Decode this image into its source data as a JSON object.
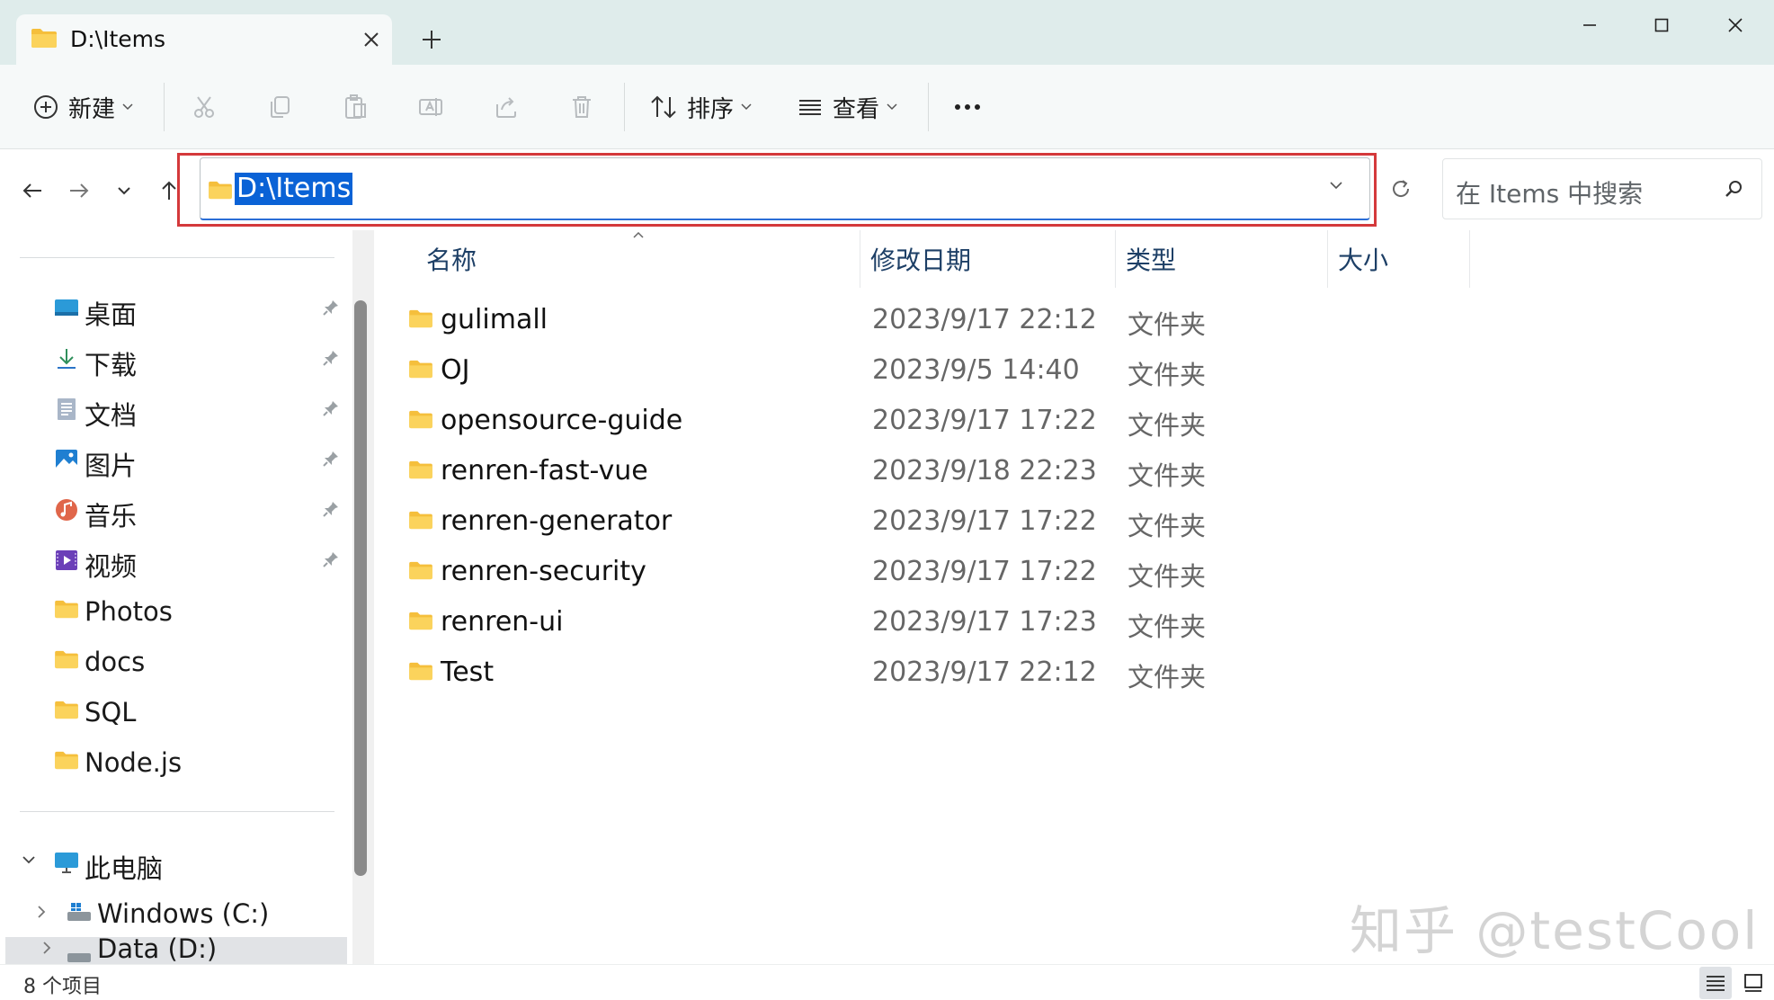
{
  "tab": {
    "title": "D:\\Items"
  },
  "toolbar": {
    "new_label": "新建",
    "sort_label": "排序",
    "view_label": "查看",
    "more_label": "···"
  },
  "address": {
    "path": "D:\\Items"
  },
  "search": {
    "placeholder": "在 Items 中搜索"
  },
  "sidebar": {
    "quick_access": [
      {
        "label": "桌面",
        "icon": "desktop-icon",
        "pinned": true
      },
      {
        "label": "下载",
        "icon": "download-icon",
        "pinned": true
      },
      {
        "label": "文档",
        "icon": "documents-icon",
        "pinned": true
      },
      {
        "label": "图片",
        "icon": "pictures-icon",
        "pinned": true
      },
      {
        "label": "音乐",
        "icon": "music-icon",
        "pinned": true
      },
      {
        "label": "视频",
        "icon": "videos-icon",
        "pinned": true
      },
      {
        "label": "Photos",
        "icon": "folder-icon",
        "pinned": false
      },
      {
        "label": "docs",
        "icon": "folder-icon",
        "pinned": false
      },
      {
        "label": "SQL",
        "icon": "folder-icon",
        "pinned": false
      },
      {
        "label": "Node.js",
        "icon": "folder-icon",
        "pinned": false
      }
    ],
    "this_pc": "此电脑",
    "drives": [
      {
        "label": "Windows (C:)",
        "icon": "drive-icon"
      },
      {
        "label": "Data (D:)",
        "icon": "drive-icon"
      }
    ]
  },
  "columns": {
    "name": "名称",
    "modified": "修改日期",
    "type": "类型",
    "size": "大小"
  },
  "files": [
    {
      "name": "gulimall",
      "modified": "2023/9/17 22:12",
      "type": "文件夹"
    },
    {
      "name": "OJ",
      "modified": "2023/9/5 14:40",
      "type": "文件夹"
    },
    {
      "name": "opensource-guide",
      "modified": "2023/9/17 17:22",
      "type": "文件夹"
    },
    {
      "name": "renren-fast-vue",
      "modified": "2023/9/18 22:23",
      "type": "文件夹"
    },
    {
      "name": "renren-generator",
      "modified": "2023/9/17 17:22",
      "type": "文件夹"
    },
    {
      "name": "renren-security",
      "modified": "2023/9/17 17:22",
      "type": "文件夹"
    },
    {
      "name": "renren-ui",
      "modified": "2023/9/17 17:23",
      "type": "文件夹"
    },
    {
      "name": "Test",
      "modified": "2023/9/17 22:12",
      "type": "文件夹"
    }
  ],
  "status": {
    "item_count": "8 个项目"
  },
  "watermark": "知乎 @testCool",
  "colors": {
    "accent": "#0a62d6",
    "highlight_border": "#d4393b",
    "folder": "#f7c948",
    "header_text": "#1d3f66"
  }
}
